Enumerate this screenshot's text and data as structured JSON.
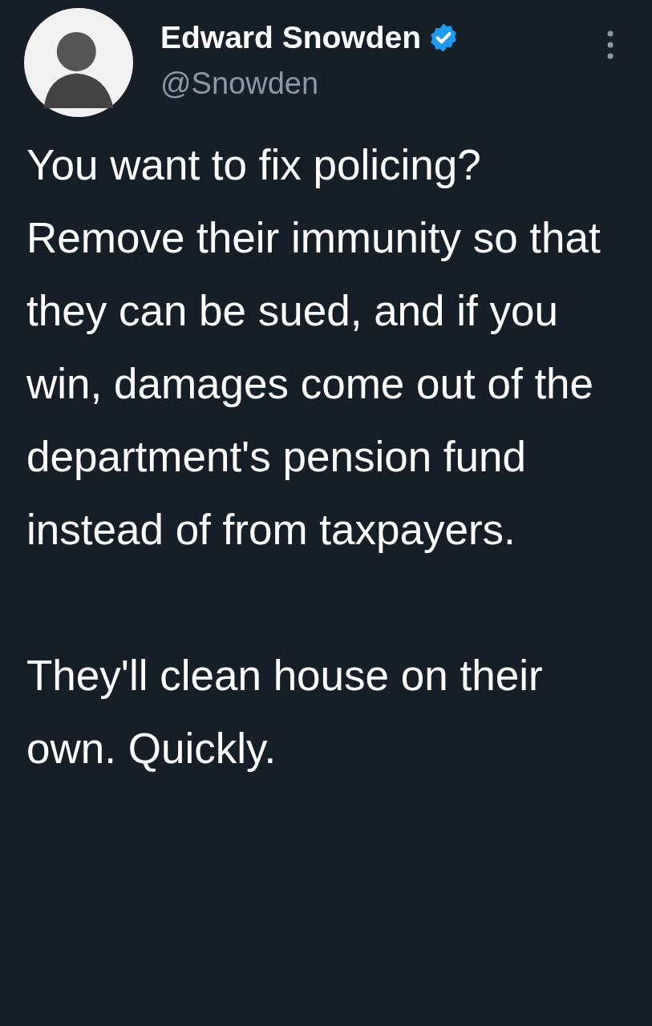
{
  "author": {
    "name": "Edward Snowden",
    "handle": "@Snowden",
    "verified": true
  },
  "tweet": {
    "paragraphs": [
      "You want to fix policing? Remove their immunity so that they can be sued, and if you win, damages come out of the department's pension fund instead of from taxpayers.",
      "They'll clean house on their own. Quickly."
    ]
  }
}
